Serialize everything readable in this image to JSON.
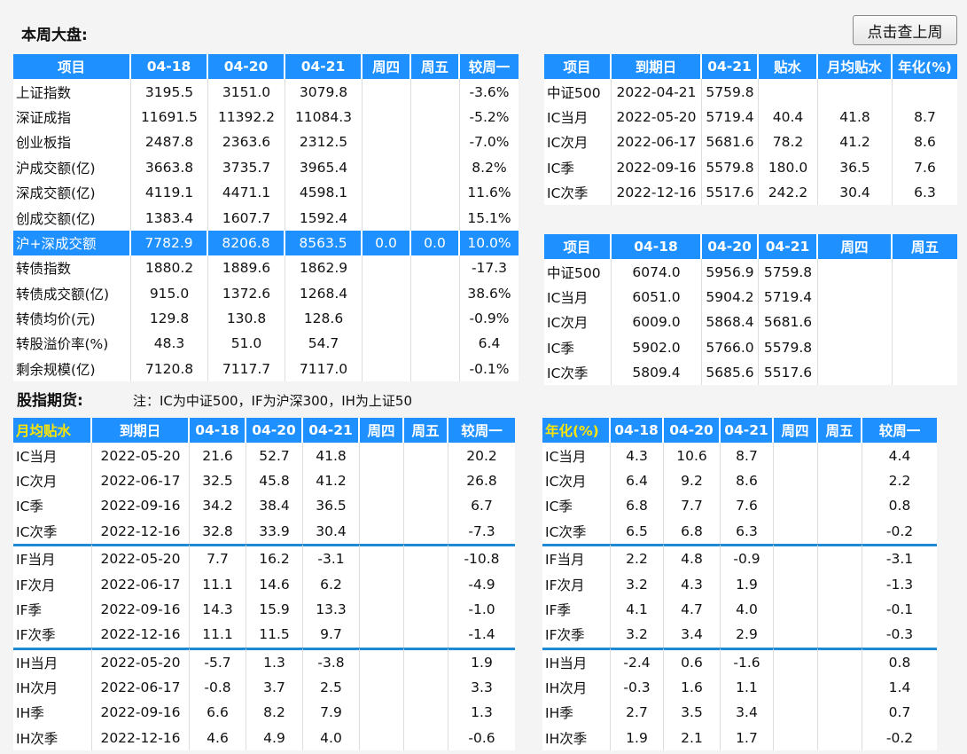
{
  "page": {
    "week_title": "本周大盘:",
    "refresh_button": "点击查上周",
    "futures_title": "股指期货:",
    "futures_note": "注：IC为中证500，IF为沪深300，IH为上证50"
  },
  "market": {
    "headers": [
      "项目",
      "04-18",
      "04-20",
      "04-21",
      "周四",
      "周五",
      "较周一"
    ],
    "rows": [
      [
        "上证指数",
        "3195.5",
        "3151.0",
        "3079.8",
        "",
        "",
        "-3.6%"
      ],
      [
        "深证成指",
        "11691.5",
        "11392.2",
        "11084.3",
        "",
        "",
        "-5.2%"
      ],
      [
        "创业板指",
        "2487.8",
        "2363.6",
        "2312.5",
        "",
        "",
        "-7.0%"
      ],
      [
        "沪成交额(亿)",
        "3663.8",
        "3735.7",
        "3965.4",
        "",
        "",
        "8.2%"
      ],
      [
        "深成交额(亿)",
        "4119.1",
        "4471.1",
        "4598.1",
        "",
        "",
        "11.6%"
      ],
      [
        "创成交额(亿)",
        "1383.4",
        "1607.7",
        "1592.4",
        "",
        "",
        "15.1%"
      ],
      [
        "沪+深成交额",
        "7782.9",
        "8206.8",
        "8563.5",
        "0.0",
        "0.0",
        "10.0%"
      ],
      [
        "转债指数",
        "1880.2",
        "1889.6",
        "1862.9",
        "",
        "",
        "-17.3"
      ],
      [
        "转债成交额(亿)",
        "915.0",
        "1372.6",
        "1268.4",
        "",
        "",
        "38.6%"
      ],
      [
        "转债均价(元)",
        "129.8",
        "130.8",
        "128.6",
        "",
        "",
        "-0.9%"
      ],
      [
        "转股溢价率(%)",
        "48.3",
        "51.0",
        "54.7",
        "",
        "",
        "6.4"
      ],
      [
        "剩余规模(亿)",
        "7120.8",
        "7117.7",
        "7117.0",
        "",
        "",
        "-0.1%"
      ]
    ]
  },
  "contracts": {
    "headers": [
      "项目",
      "到期日",
      "04-21",
      "贴水",
      "月均贴水",
      "年化(%)"
    ],
    "rows": [
      [
        "中证500",
        "2022-04-21",
        "5759.8",
        "",
        "",
        ""
      ],
      [
        "IC当月",
        "2022-05-20",
        "5719.4",
        "40.4",
        "41.8",
        "8.7"
      ],
      [
        "IC次月",
        "2022-06-17",
        "5681.6",
        "78.2",
        "41.2",
        "8.6"
      ],
      [
        "IC季",
        "2022-09-16",
        "5579.8",
        "180.0",
        "36.5",
        "7.6"
      ],
      [
        "IC次季",
        "2022-12-16",
        "5517.6",
        "242.2",
        "30.4",
        "6.3"
      ]
    ]
  },
  "prices": {
    "headers": [
      "项目",
      "04-18",
      "04-20",
      "04-21",
      "周四",
      "周五"
    ],
    "rows": [
      [
        "中证500",
        "6074.0",
        "5956.9",
        "5759.8",
        "",
        ""
      ],
      [
        "IC当月",
        "6051.0",
        "5904.2",
        "5719.4",
        "",
        ""
      ],
      [
        "IC次月",
        "6009.0",
        "5868.4",
        "5681.6",
        "",
        ""
      ],
      [
        "IC季",
        "5902.0",
        "5766.0",
        "5579.8",
        "",
        ""
      ],
      [
        "IC次季",
        "5809.4",
        "5685.6",
        "5517.6",
        "",
        ""
      ]
    ]
  },
  "monthly_discount": {
    "headers": [
      "月均贴水",
      "到期日",
      "04-18",
      "04-20",
      "04-21",
      "周四",
      "周五",
      "较周一"
    ],
    "rows": [
      [
        "IC当月",
        "2022-05-20",
        "21.6",
        "52.7",
        "41.8",
        "",
        "",
        "20.2"
      ],
      [
        "IC次月",
        "2022-06-17",
        "32.5",
        "45.8",
        "41.2",
        "",
        "",
        "26.8"
      ],
      [
        "IC季",
        "2022-09-16",
        "34.2",
        "38.4",
        "36.5",
        "",
        "",
        "6.7"
      ],
      [
        "IC次季",
        "2022-12-16",
        "32.8",
        "33.9",
        "30.4",
        "",
        "",
        "-7.3"
      ],
      [
        "IF当月",
        "2022-05-20",
        "7.7",
        "16.2",
        "-3.1",
        "",
        "",
        "-10.8"
      ],
      [
        "IF次月",
        "2022-06-17",
        "11.1",
        "14.6",
        "6.2",
        "",
        "",
        "-4.9"
      ],
      [
        "IF季",
        "2022-09-16",
        "14.3",
        "15.9",
        "13.3",
        "",
        "",
        "-1.0"
      ],
      [
        "IF次季",
        "2022-12-16",
        "11.1",
        "11.5",
        "9.7",
        "",
        "",
        "-1.4"
      ],
      [
        "IH当月",
        "2022-05-20",
        "-5.7",
        "1.3",
        "-3.8",
        "",
        "",
        "1.9"
      ],
      [
        "IH次月",
        "2022-06-17",
        "-0.8",
        "3.7",
        "2.5",
        "",
        "",
        "3.3"
      ],
      [
        "IH季",
        "2022-09-16",
        "6.6",
        "8.2",
        "7.9",
        "",
        "",
        "1.3"
      ],
      [
        "IH次季",
        "2022-12-16",
        "4.6",
        "4.9",
        "4.0",
        "",
        "",
        "-0.6"
      ]
    ]
  },
  "annualized": {
    "headers": [
      "年化(%)",
      "04-18",
      "04-20",
      "04-21",
      "周四",
      "周五",
      "较周一"
    ],
    "rows": [
      [
        "IC当月",
        "4.3",
        "10.6",
        "8.7",
        "",
        "",
        "4.4"
      ],
      [
        "IC次月",
        "6.4",
        "9.2",
        "8.6",
        "",
        "",
        "2.2"
      ],
      [
        "IC季",
        "6.8",
        "7.7",
        "7.6",
        "",
        "",
        "0.8"
      ],
      [
        "IC次季",
        "6.5",
        "6.8",
        "6.3",
        "",
        "",
        "-0.2"
      ],
      [
        "IF当月",
        "2.2",
        "4.8",
        "-0.9",
        "",
        "",
        "-3.1"
      ],
      [
        "IF次月",
        "3.2",
        "4.3",
        "1.9",
        "",
        "",
        "-1.3"
      ],
      [
        "IF季",
        "4.1",
        "4.7",
        "4.0",
        "",
        "",
        "-0.1"
      ],
      [
        "IF次季",
        "3.2",
        "3.4",
        "2.9",
        "",
        "",
        "-0.3"
      ],
      [
        "IH当月",
        "-2.4",
        "0.6",
        "-1.6",
        "",
        "",
        "0.8"
      ],
      [
        "IH次月",
        "-0.3",
        "1.6",
        "1.1",
        "",
        "",
        "1.4"
      ],
      [
        "IH季",
        "2.7",
        "3.5",
        "3.4",
        "",
        "",
        "0.7"
      ],
      [
        "IH次季",
        "1.9",
        "2.1",
        "1.7",
        "",
        "",
        "-0.2"
      ]
    ]
  }
}
